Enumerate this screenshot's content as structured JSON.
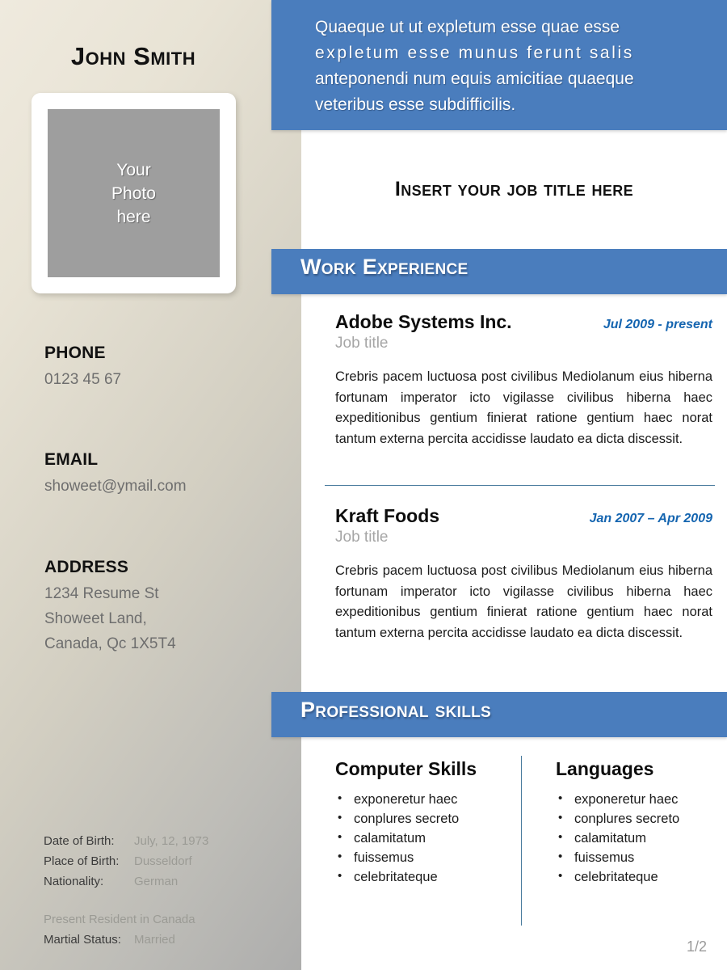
{
  "sidebar": {
    "name": "John Smith",
    "photo_placeholder": [
      "Your",
      "Photo",
      "here"
    ],
    "contact": [
      {
        "label": "PHONE",
        "value": "0123 45 67"
      },
      {
        "label": "EMAIL",
        "value": "showeet@ymail.com"
      },
      {
        "label": "ADDRESS",
        "value_lines": [
          "1234 Resume St",
          "Showeet Land,",
          "Canada, Qc 1X5T4"
        ]
      }
    ],
    "address_line_1": "1234 Resume St",
    "address_line_2": "Showeet Land,",
    "address_line_3": "Canada, Qc 1X5T4",
    "personal_details": {
      "rows": [
        {
          "key": "Date of Birth:",
          "value": "July, 12, 1973"
        },
        {
          "key": "Place of Birth:",
          "value": "Dusseldorf"
        },
        {
          "key": "Nationality:",
          "value": "German"
        }
      ],
      "residency_note": "Present Resident in Canada",
      "marital_row": {
        "key": "Martial Status:",
        "value": "Married"
      }
    }
  },
  "summary": {
    "line1": "Quaeque ut ut expletum esse quae esse",
    "line2": "expletum esse munus ferunt salis",
    "line3": "anteponendi num equis amicitiae quaeque",
    "line4": "veteribus esse subdifficilis."
  },
  "job_title_header": "Insert your job title here",
  "sections": {
    "work_experience_title": "Work Experience",
    "professional_skills_title": "Professional skills"
  },
  "jobs": [
    {
      "company": "Adobe Systems Inc.",
      "dates": "Jul 2009 - present",
      "role": "Job title",
      "description": "Crebris pacem luctuosa post civilibus Mediolanum eius hiberna fortunam imperator icto vigilasse civilibus hiberna haec expeditionibus gentium finierat ratione gentium haec norat tantum externa percita accidisse laudato ea dicta discessit."
    },
    {
      "company": "Kraft Foods",
      "dates": "Jan 2007 – Apr 2009",
      "role": "Job title",
      "description": "Crebris pacem luctuosa post civilibus Mediolanum eius hiberna fortunam imperator icto vigilasse civilibus hiberna haec expeditionibus gentium finierat ratione gentium haec norat tantum externa percita accidisse laudato ea dicta discessit."
    }
  ],
  "skills": {
    "computer": {
      "heading": "Computer Skills",
      "items": [
        "exponeretur haec",
        "conplures secreto",
        "calamitatum",
        "fuissemus",
        "celebritateque"
      ]
    },
    "languages": {
      "heading": "Languages",
      "items": [
        "exponeretur haec",
        "conplures secreto",
        "calamitatum",
        "fuissemus",
        "celebritateque"
      ]
    }
  },
  "page_number": "1/2",
  "colors": {
    "accent_blue": "#4a7dbd",
    "fold_blue": "#2f5b91",
    "date_blue": "#1565b0",
    "divider_blue": "#4a7c9e",
    "sidebar_light": "#efeade",
    "sidebar_dark": "#adadac",
    "photo_gray": "#9e9e9e"
  }
}
